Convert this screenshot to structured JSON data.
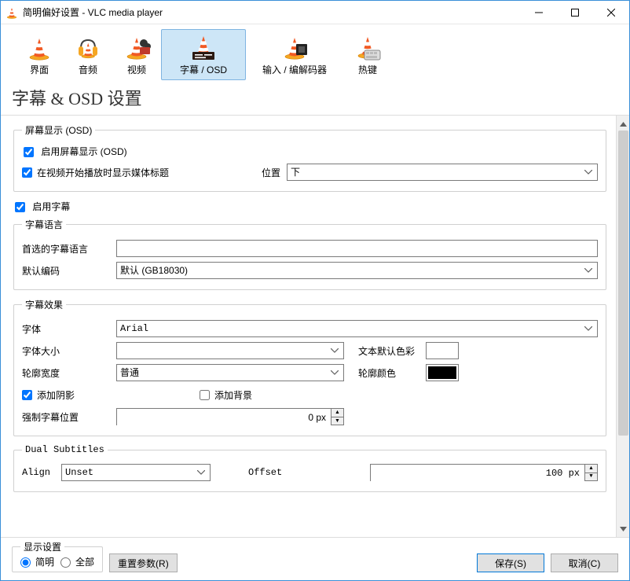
{
  "window": {
    "title": "简明偏好设置 - VLC media player"
  },
  "categories": {
    "interface": "界面",
    "audio": "音频",
    "video": "视频",
    "subtitles": "字幕 / OSD",
    "input": "输入 / 编解码器",
    "hotkeys": "热键"
  },
  "heading": "字幕 & OSD 设置",
  "osd": {
    "legend": "屏幕显示 (OSD)",
    "enable_osd": "启用屏幕显示 (OSD)",
    "enable_osd_checked": true,
    "show_title": "在视频开始播放时显示媒体标题",
    "show_title_checked": true,
    "position_label": "位置",
    "position_value": "下"
  },
  "enable_subs": {
    "label": "启用字幕",
    "checked": true
  },
  "sublang": {
    "legend": "字幕语言",
    "preferred_label": "首选的字幕语言",
    "preferred_value": "",
    "encoding_label": "默认编码",
    "encoding_value": "默认 (GB18030)"
  },
  "subeffect": {
    "legend": "字幕效果",
    "font_label": "字体",
    "font_value": "Arial",
    "size_label": "字体大小",
    "size_value": "",
    "textcolor_label": "文本默认色彩",
    "textcolor_value": "#ffffff",
    "outlinewidth_label": "轮廓宽度",
    "outlinewidth_value": "普通",
    "outlinecolor_label": "轮廓颜色",
    "outlinecolor_value": "#000000",
    "shadow_label": "添加阴影",
    "shadow_checked": true,
    "bg_label": "添加背景",
    "bg_checked": false,
    "forcepos_label": "强制字幕位置",
    "forcepos_value": "0 px"
  },
  "dual": {
    "legend": "Dual Subtitles",
    "align_label": "Align",
    "align_value": "Unset",
    "offset_label": "Offset",
    "offset_value": "100 px"
  },
  "bottom": {
    "show_legend": "显示设置",
    "simple": "简明",
    "all": "全部",
    "mode_simple_checked": true,
    "reset": "重置参数(R)",
    "save": "保存(S)",
    "cancel": "取消(C)"
  }
}
